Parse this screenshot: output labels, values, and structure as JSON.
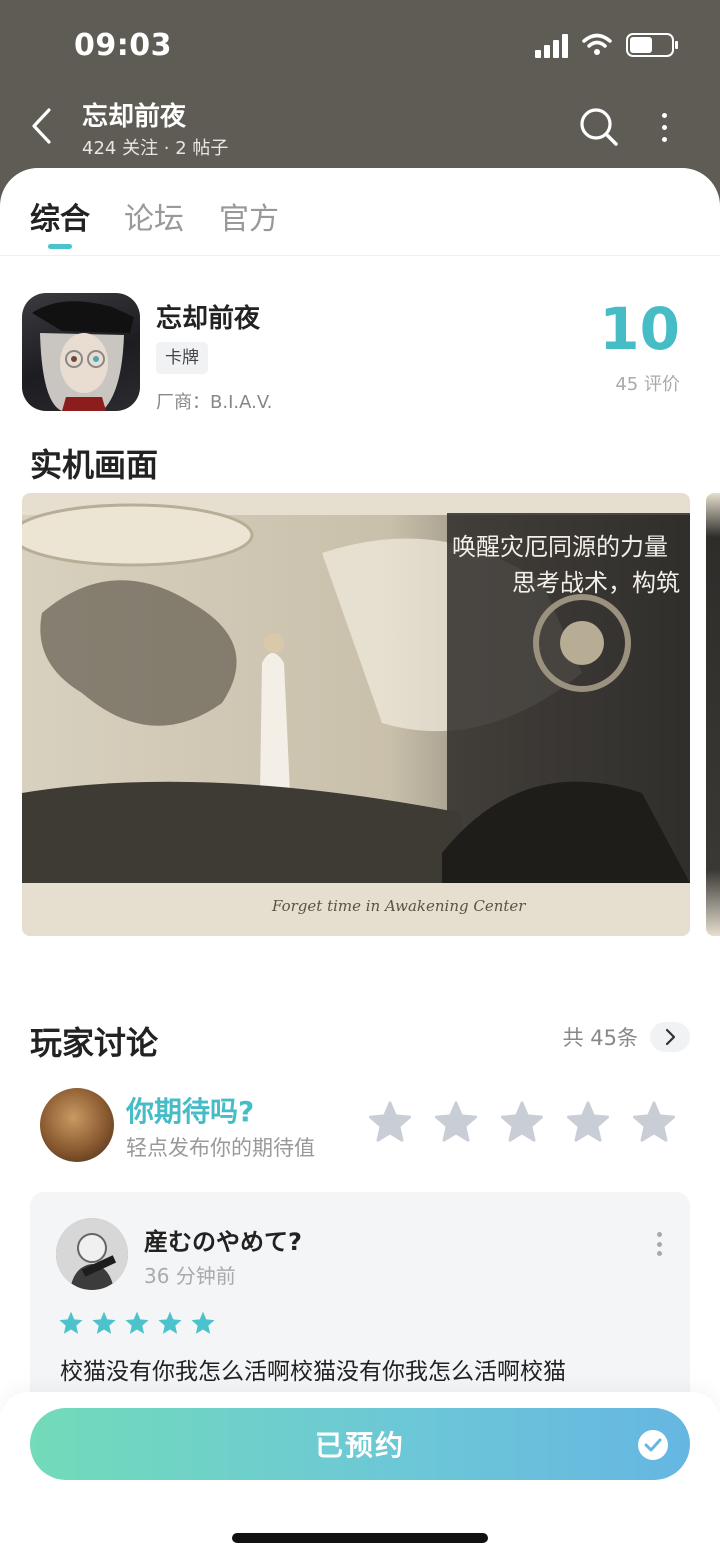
{
  "status_bar": {
    "time": "09:03",
    "battery_level": 0.55
  },
  "header": {
    "title": "忘却前夜",
    "subtitle": "424 关注 · 2 帖子"
  },
  "tabs": [
    {
      "label": "综合",
      "active": true
    },
    {
      "label": "论坛",
      "active": false
    },
    {
      "label": "官方",
      "active": false
    }
  ],
  "game": {
    "name": "忘却前夜",
    "tag": "卡牌",
    "vendor": "厂商：B.I.A.V.",
    "score": "10",
    "rating_count": "45 评价"
  },
  "screenshots_section": {
    "title": "实机画面"
  },
  "screenshots": [
    {
      "caption_line1": "唤醒灾厄同源的力量",
      "caption_line2": "思考战术，构筑",
      "signature": "Forget time in Awakening Center"
    }
  ],
  "discussion": {
    "title": "玩家讨论",
    "total": "共 45条",
    "expect_question": "你期待吗?",
    "expect_hint": "轻点发布你的期待值",
    "rating_stars": 5
  },
  "review": {
    "author": "産むのやめて?",
    "time": "36 分钟前",
    "stars": 5,
    "text": "校猫没有你我怎么活啊校猫没有你我怎么活啊校猫"
  },
  "bottom": {
    "reserve_label": "已预约"
  },
  "colors": {
    "accent": "#46bcc7",
    "header_bg": "#5f5c56",
    "star_gray": "#c9ced6",
    "star_teal": "#4cc3cc"
  }
}
